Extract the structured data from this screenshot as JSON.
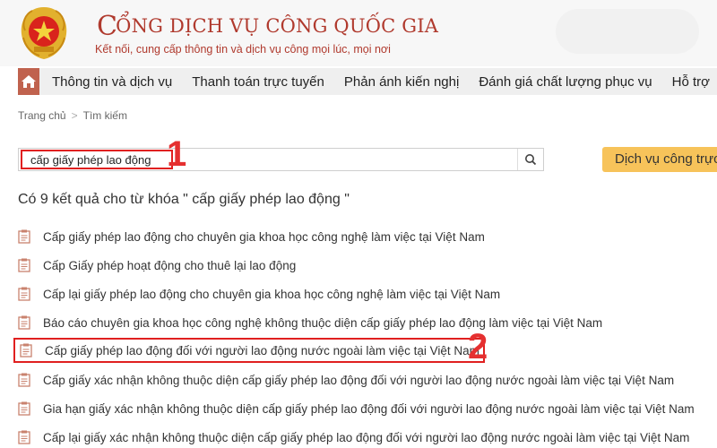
{
  "header": {
    "title": "ỔNG DỊCH VỤ CÔNG QUỐC GIA",
    "title_initial": "C",
    "tagline": "Kết nối, cung cấp thông tin và dịch vụ công mọi lúc, mọi nơi",
    "emblem_icon": "national-emblem-icon"
  },
  "nav": {
    "home_icon": "home-icon",
    "items": [
      "Thông tin và dịch vụ",
      "Thanh toán trực tuyến",
      "Phản ánh kiến nghị",
      "Đánh giá chất lượng phục vụ",
      "Hỗ trợ"
    ]
  },
  "breadcrumb": {
    "home": "Trang chủ",
    "separator": ">",
    "current": "Tìm kiếm"
  },
  "search": {
    "value": "cấp giấy phép lao động",
    "icon": "search-icon"
  },
  "service_button": "Dịch vụ công trực",
  "markers": {
    "one": "1",
    "two": "2"
  },
  "results": {
    "heading": "Có 9 kết quả cho từ khóa \" cấp giấy phép lao động \"",
    "items": [
      "Cấp giấy phép lao động cho chuyên gia khoa học công nghệ làm việc tại Việt Nam",
      "Cấp Giấy phép hoạt động cho thuê lại lao động",
      "Cấp lại giấy phép lao động cho chuyên gia khoa học công nghệ làm việc tại Việt Nam",
      "Báo cáo chuyên gia khoa học công nghệ không thuộc diện cấp giấy phép lao động làm việc tại Việt Nam",
      "Cấp giấy phép lao động đối với người lao động nước ngoài làm việc tại Việt Nam",
      "Cấp giấy xác nhận không thuộc diện cấp giấy phép lao động đối với người lao động nước ngoài làm việc tại Việt Nam",
      "Gia hạn giấy xác nhận không thuộc diện cấp giấy phép lao động đối với người lao động nước ngoài làm việc tại Việt Nam",
      "Cấp lại giấy xác nhận không thuộc diện cấp giấy phép lao động đối với người lao động nước ngoài làm việc tại Việt Nam"
    ],
    "item_icon": "document-icon"
  },
  "colors": {
    "brand_red": "#b03a2e",
    "home_tile": "#c0624e",
    "service_button": "#f7c35a",
    "highlight_red": "#e02020"
  }
}
